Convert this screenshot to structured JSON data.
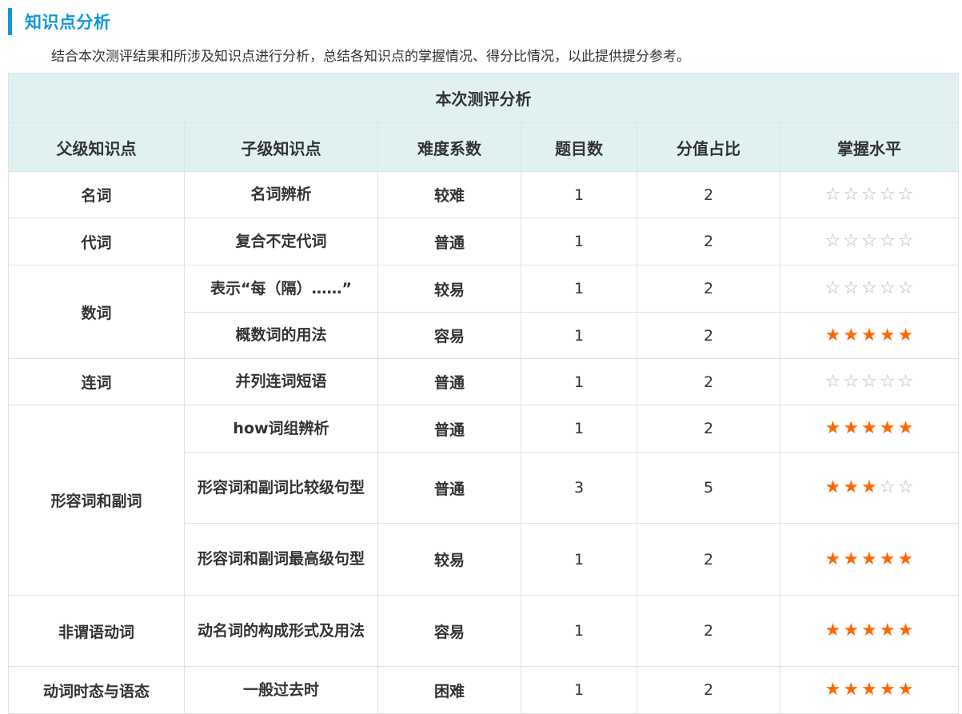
{
  "section": {
    "title": "知识点分析",
    "intro": "结合本次测评结果和所涉及知识点进行分析，总结各知识点的掌握情况、得分比情况，以此提供提分参考。"
  },
  "table": {
    "caption": "本次测评分析",
    "headers": [
      "父级知识点",
      "子级知识点",
      "难度系数",
      "题目数",
      "分值占比",
      "掌握水平"
    ],
    "groups": [
      {
        "parent": "名词",
        "rows": [
          {
            "child": "名词辨析",
            "difficulty": "较难",
            "count": "1",
            "score": "2",
            "mastery": 0
          }
        ]
      },
      {
        "parent": "代词",
        "rows": [
          {
            "child": "复合不定代词",
            "difficulty": "普通",
            "count": "1",
            "score": "2",
            "mastery": 0
          }
        ]
      },
      {
        "parent": "数词",
        "rows": [
          {
            "child": "表示“每（隔）……”",
            "difficulty": "较易",
            "count": "1",
            "score": "2",
            "mastery": 0
          },
          {
            "child": "概数词的用法",
            "difficulty": "容易",
            "count": "1",
            "score": "2",
            "mastery": 5
          }
        ]
      },
      {
        "parent": "连词",
        "rows": [
          {
            "child": "并列连词短语",
            "difficulty": "普通",
            "count": "1",
            "score": "2",
            "mastery": 0
          }
        ]
      },
      {
        "parent": "形容词和副词",
        "rows": [
          {
            "child": "how词组辨析",
            "difficulty": "普通",
            "count": "1",
            "score": "2",
            "mastery": 5
          },
          {
            "child": "形容词和副词比较级句型",
            "difficulty": "普通",
            "count": "3",
            "score": "5",
            "mastery": 3
          },
          {
            "child": "形容词和副词最高级句型",
            "difficulty": "较易",
            "count": "1",
            "score": "2",
            "mastery": 5
          }
        ]
      },
      {
        "parent": "非谓语动词",
        "rows": [
          {
            "child": "动名词的构成形式及用法",
            "difficulty": "容易",
            "count": "1",
            "score": "2",
            "mastery": 5
          }
        ]
      },
      {
        "parent": "动词时态与语态",
        "rows": [
          {
            "child": "一般过去时",
            "difficulty": "困难",
            "count": "1",
            "score": "2",
            "mastery": 5
          }
        ]
      }
    ],
    "star_max": 5,
    "star_on_glyph": "★",
    "star_off_glyph": "☆"
  },
  "colors": {
    "accent": "#1296db",
    "header_bg": "#e1f1f1",
    "star_on": "#ff6600",
    "star_off": "#b8b8b8"
  }
}
